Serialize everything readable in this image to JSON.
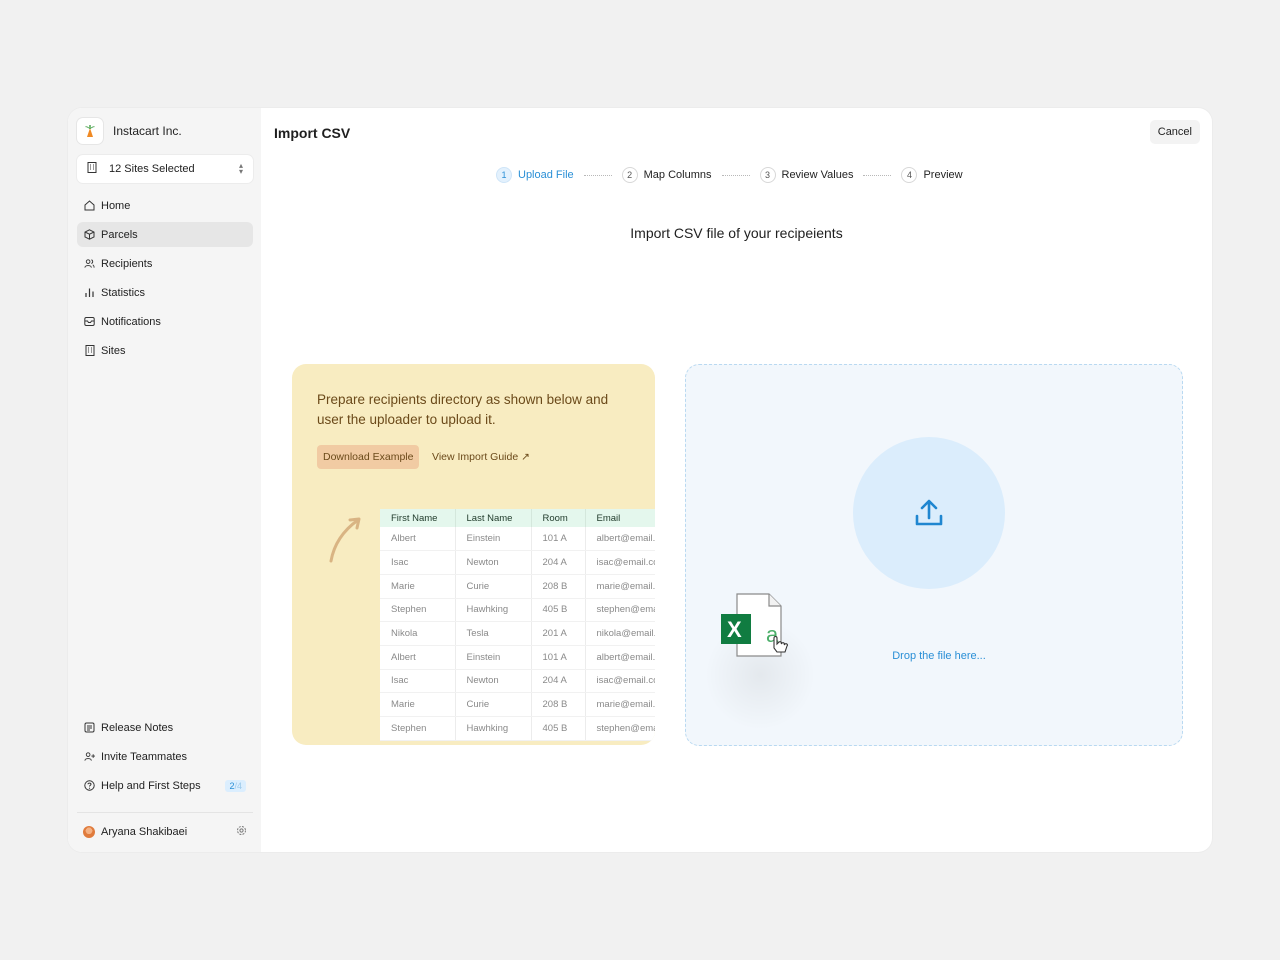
{
  "org": {
    "name": "Instacart Inc."
  },
  "site_selector": {
    "label": "12 Sites Selected"
  },
  "nav": [
    {
      "label": "Home",
      "icon": "home-icon"
    },
    {
      "label": "Parcels",
      "icon": "package-icon",
      "active": true
    },
    {
      "label": "Recipients",
      "icon": "users-icon"
    },
    {
      "label": "Statistics",
      "icon": "bar-chart-icon"
    },
    {
      "label": "Notifications",
      "icon": "inbox-icon"
    },
    {
      "label": "Sites",
      "icon": "building-icon"
    }
  ],
  "bottom_nav": [
    {
      "label": "Release Notes",
      "icon": "notes-icon"
    },
    {
      "label": "Invite Teammates",
      "icon": "user-plus-icon"
    },
    {
      "label": "Help and First Steps",
      "icon": "help-icon",
      "badge_done": "2",
      "badge_sep": "/",
      "badge_total": "4"
    }
  ],
  "user": {
    "name": "Aryana Shakibaei"
  },
  "page": {
    "title": "Import CSV",
    "cancel_label": "Cancel"
  },
  "steps": [
    {
      "num": "1",
      "label": "Upload File",
      "active": true
    },
    {
      "num": "2",
      "label": "Map Columns"
    },
    {
      "num": "3",
      "label": "Review Values"
    },
    {
      "num": "4",
      "label": "Preview"
    }
  ],
  "heading": "Import CSV file of your recipeients",
  "instructions": {
    "text": "Prepare recipients directory as shown below and user the uploader to upload it.",
    "download_label": "Download Example",
    "guide_label": "View Import Guide ↗"
  },
  "example_table": {
    "columns": [
      "First Name",
      "Last Name",
      "Room",
      "Email"
    ],
    "rows": [
      [
        "Albert",
        "Einstein",
        "101 A",
        "albert@email.c"
      ],
      [
        "Isac",
        "Newton",
        "204 A",
        "isac@email.co"
      ],
      [
        "Marie",
        "Curie",
        "208 B",
        "marie@email.c"
      ],
      [
        "Stephen",
        "Hawhking",
        "405 B",
        "stephen@ema"
      ],
      [
        "Nikola",
        "Tesla",
        "201 A",
        "nikola@email.c"
      ],
      [
        "Albert",
        "Einstein",
        "101 A",
        "albert@email.c"
      ],
      [
        "Isac",
        "Newton",
        "204 A",
        "isac@email.co"
      ],
      [
        "Marie",
        "Curie",
        "208 B",
        "marie@email.c"
      ],
      [
        "Stephen",
        "Hawhking",
        "405 B",
        "stephen@ema"
      ]
    ]
  },
  "dropzone": {
    "text": "Drop the file here...",
    "icon": "upload-icon"
  },
  "colors": {
    "accent": "#2a8fd6",
    "yellow_bg": "#f8ecc1",
    "excel_green": "#107c41"
  }
}
